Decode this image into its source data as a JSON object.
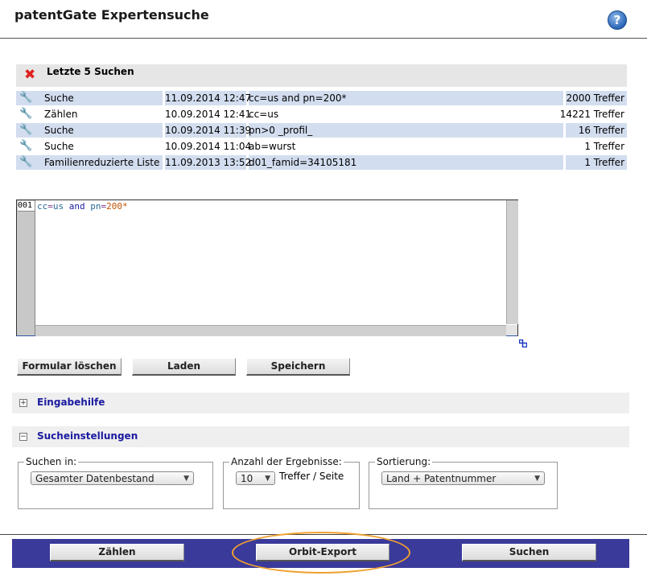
{
  "header": {
    "title": "patentGate Expertensuche",
    "help_label": "?"
  },
  "recent": {
    "title": "Letzte 5 Suchen",
    "rows": [
      {
        "type": "Suche",
        "datetime": "11.09.2014 12:47",
        "query": "cc=us and pn=200*",
        "hits": "2000 Treffer"
      },
      {
        "type": "Zählen",
        "datetime": "10.09.2014 12:41",
        "query": "cc=us",
        "hits": "14221 Treffer"
      },
      {
        "type": "Suche",
        "datetime": "10.09.2014 11:39",
        "query": "pn>0 _profil_",
        "hits": "16 Treffer"
      },
      {
        "type": "Suche",
        "datetime": "10.09.2014 11:04",
        "query": "ab=wurst",
        "hits": "1 Treffer"
      },
      {
        "type": "Familienreduzierte Liste",
        "datetime": "11.09.2013 13:52",
        "query": "d01_famid=34105181",
        "hits": "1 Treffer"
      }
    ]
  },
  "editor": {
    "line_number": "001",
    "tokens": {
      "field1": "cc",
      "op1": "=",
      "val1": "us",
      "kw": "and",
      "field2": "pn",
      "op2": "=",
      "val2": "200*"
    }
  },
  "buttons": {
    "clear": "Formular löschen",
    "load": "Laden",
    "save": "Speichern"
  },
  "sections": {
    "input_help": "Eingabehilfe",
    "input_help_toggle": "+",
    "settings": "Sucheinstellungen",
    "settings_toggle": "−"
  },
  "settings": {
    "search_in": {
      "legend": "Suchen in:",
      "value": "Gesamter Datenbestand"
    },
    "result_count": {
      "legend": "Anzahl der Ergebnisse:",
      "value": "10",
      "suffix": "Treffer / Seite"
    },
    "sort": {
      "legend": "Sortierung:",
      "value": "Land + Patentnummer"
    }
  },
  "footer": {
    "count": "Zählen",
    "orbit": "Orbit-Export",
    "search": "Suchen"
  },
  "colors": {
    "footer_bar": "#3a3a9a",
    "highlight_oval": "#f0a030",
    "row_alt": "#d2ddef",
    "link_blue": "#1a1aa0"
  }
}
